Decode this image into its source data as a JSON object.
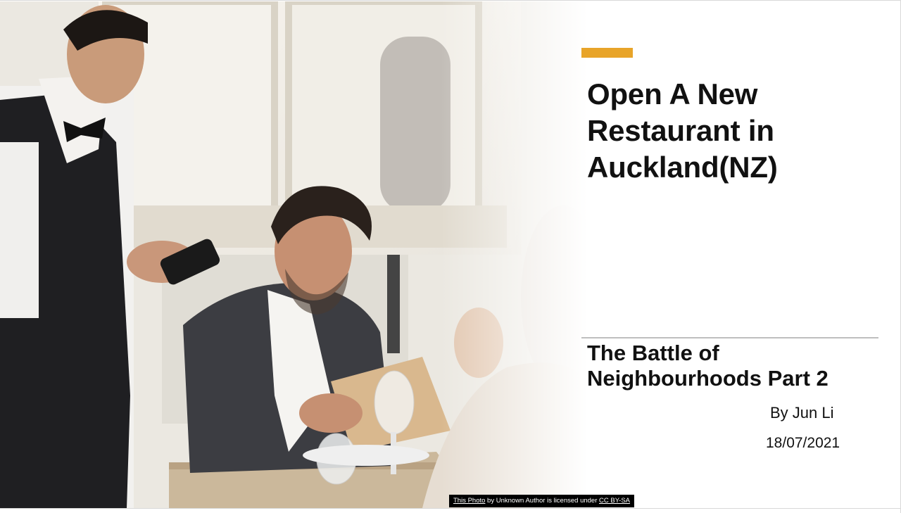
{
  "slide": {
    "title": "Open A New\nRestaurant in\nAuckland(NZ)",
    "subtitle": "The Battle of\nNeighbourhoods Part 2",
    "author": "By Jun Li",
    "date": "18/07/2021",
    "accent_color": "#e8a429"
  },
  "attribution": {
    "link_photo": "This Photo",
    "middle": " by Unknown Author is licensed under ",
    "link_license": "CC BY-SA"
  }
}
